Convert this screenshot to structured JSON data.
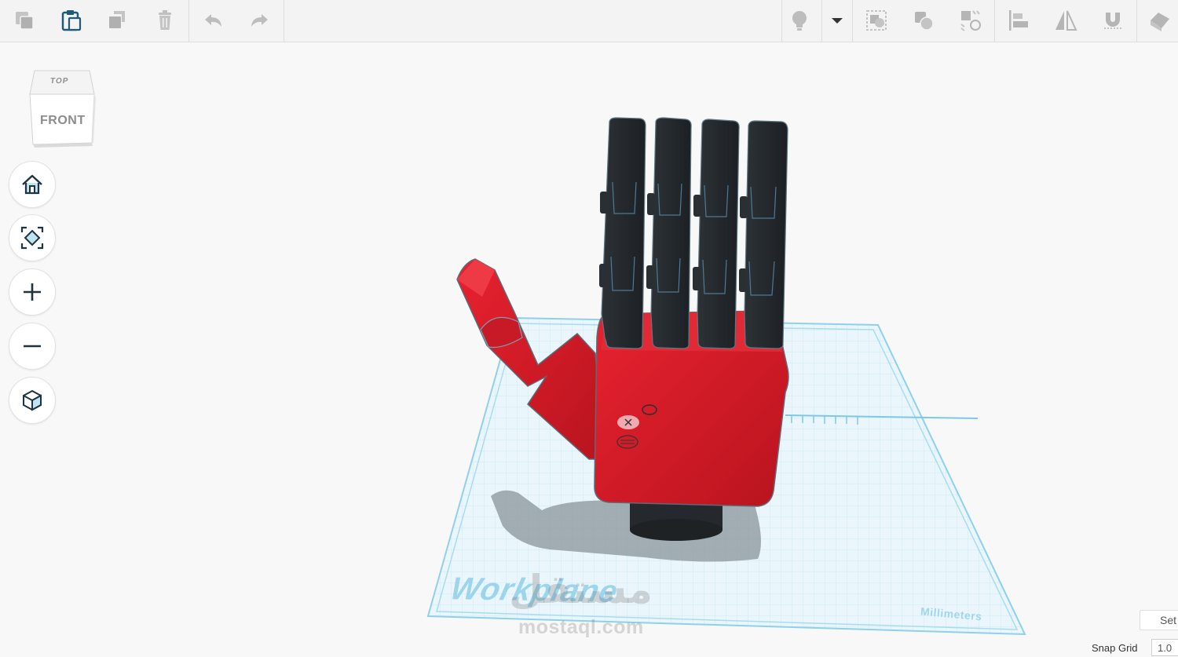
{
  "toolbar": {
    "left_tools": [
      "copy-icon",
      "paste-icon",
      "duplicate-icon",
      "trash-icon",
      "undo-icon",
      "redo-icon"
    ],
    "right_tools": [
      "lightbulb-icon",
      "dropdown-caret-icon",
      "group-icon",
      "ungroup-icon",
      "mirror-align-icon",
      "align-icon",
      "mirror-icon",
      "magnet-icon",
      "export-icon"
    ]
  },
  "viewcube": {
    "top_label": "TOP",
    "front_label": "FRONT"
  },
  "nav_controls": [
    "home-view-icon",
    "fit-view-icon",
    "zoom-in-icon",
    "zoom-out-icon",
    "perspective-icon"
  ],
  "workplane": {
    "label": "Workplane",
    "units": "Millimeters"
  },
  "watermark": {
    "arabic": "مستقل",
    "domain": "mostaql.com"
  },
  "settings": {
    "button_label": "Set",
    "snap_grid_label": "Snap Grid",
    "snap_grid_value": "1.0"
  },
  "colors": {
    "toolbar_bg": "#f3f3f3",
    "icon_gray": "#b5b5b5",
    "icon_dark": "#1f5a78",
    "workplane_line": "#9fd6ec",
    "hand_red": "#d81e2c",
    "finger_black": "#252a2e"
  }
}
